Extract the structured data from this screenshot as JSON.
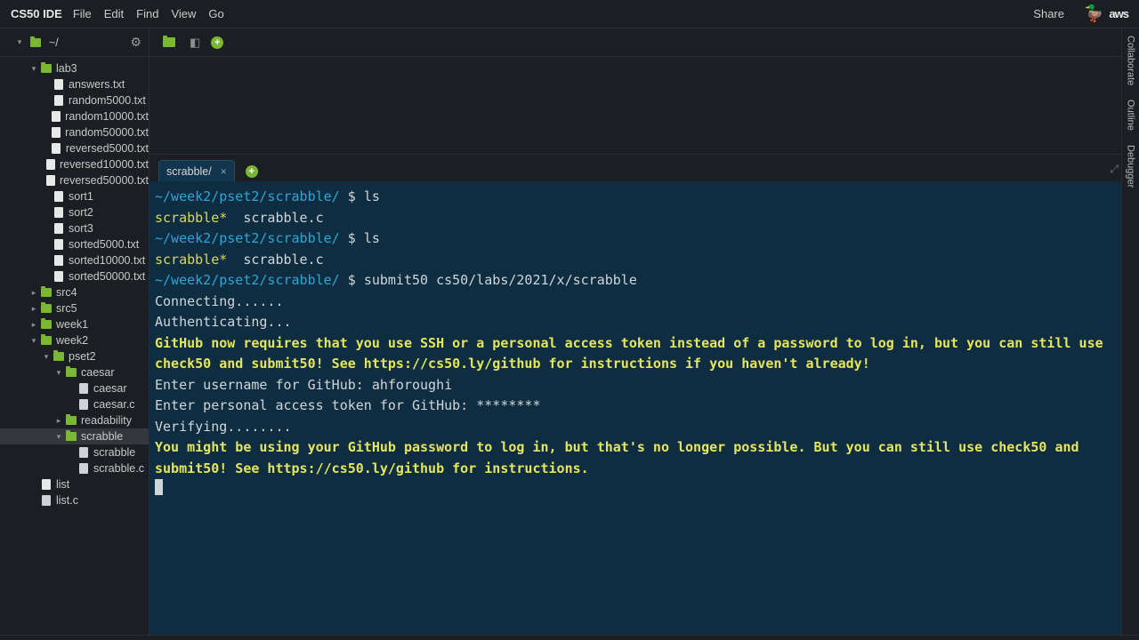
{
  "menubar": {
    "brand": "CS50 IDE",
    "items": [
      "File",
      "Edit",
      "Find",
      "View",
      "Go"
    ],
    "share": "Share",
    "cloud_brand": "aws"
  },
  "sidebar": {
    "root_label": "~/",
    "gear_icon": "gear",
    "tree": [
      {
        "depth": 0,
        "type": "folder-open",
        "twisty": true,
        "expanded": true,
        "label": "lab3"
      },
      {
        "depth": 1,
        "type": "file",
        "label": "answers.txt"
      },
      {
        "depth": 1,
        "type": "file",
        "label": "random5000.txt"
      },
      {
        "depth": 1,
        "type": "file",
        "label": "random10000.txt"
      },
      {
        "depth": 1,
        "type": "file",
        "label": "random50000.txt"
      },
      {
        "depth": 1,
        "type": "file",
        "label": "reversed5000.txt"
      },
      {
        "depth": 1,
        "type": "file",
        "label": "reversed10000.txt"
      },
      {
        "depth": 1,
        "type": "file",
        "label": "reversed50000.txt"
      },
      {
        "depth": 1,
        "type": "file",
        "label": "sort1"
      },
      {
        "depth": 1,
        "type": "file",
        "label": "sort2"
      },
      {
        "depth": 1,
        "type": "file",
        "label": "sort3"
      },
      {
        "depth": 1,
        "type": "file",
        "label": "sorted5000.txt"
      },
      {
        "depth": 1,
        "type": "file",
        "label": "sorted10000.txt"
      },
      {
        "depth": 1,
        "type": "file",
        "label": "sorted50000.txt"
      },
      {
        "depth": 0,
        "type": "folder-closed",
        "twisty": true,
        "expanded": false,
        "label": "src4"
      },
      {
        "depth": 0,
        "type": "folder-closed",
        "twisty": true,
        "expanded": false,
        "label": "src5"
      },
      {
        "depth": 0,
        "type": "folder-closed",
        "twisty": true,
        "expanded": false,
        "label": "week1"
      },
      {
        "depth": 0,
        "type": "folder-open",
        "twisty": true,
        "expanded": true,
        "label": "week2"
      },
      {
        "depth": 1,
        "type": "folder-open",
        "twisty": true,
        "expanded": true,
        "label": "pset2"
      },
      {
        "depth": 2,
        "type": "folder-open",
        "twisty": true,
        "expanded": true,
        "label": "caesar"
      },
      {
        "depth": 3,
        "type": "file",
        "docish": true,
        "label": "caesar"
      },
      {
        "depth": 3,
        "type": "file",
        "docish": true,
        "label": "caesar.c"
      },
      {
        "depth": 2,
        "type": "folder-closed",
        "twisty": true,
        "expanded": false,
        "label": "readability"
      },
      {
        "depth": 2,
        "type": "folder-open",
        "twisty": true,
        "expanded": true,
        "selected": true,
        "label": "scrabble"
      },
      {
        "depth": 3,
        "type": "file",
        "docish": true,
        "label": "scrabble"
      },
      {
        "depth": 3,
        "type": "file",
        "docish": true,
        "label": "scrabble.c"
      },
      {
        "depth": 0,
        "type": "file",
        "label": "list"
      },
      {
        "depth": 0,
        "type": "file",
        "docish": true,
        "label": "list.c"
      }
    ]
  },
  "tabs": {
    "active": "scrabble/"
  },
  "terminal": {
    "lines": [
      {
        "parts": [
          {
            "cls": "prompt",
            "t": "~/week2/pset2/scrabble/ "
          },
          {
            "cls": "dollar",
            "t": "$ "
          },
          {
            "cls": "cmd",
            "t": "ls"
          }
        ]
      },
      {
        "parts": [
          {
            "cls": "out-yellow",
            "t": "scrabble*"
          },
          {
            "cls": "cmd",
            "t": "  scrabble.c"
          }
        ]
      },
      {
        "parts": [
          {
            "cls": "prompt",
            "t": "~/week2/pset2/scrabble/ "
          },
          {
            "cls": "dollar",
            "t": "$ "
          },
          {
            "cls": "cmd",
            "t": "ls"
          }
        ]
      },
      {
        "parts": [
          {
            "cls": "out-yellow",
            "t": "scrabble*"
          },
          {
            "cls": "cmd",
            "t": "  scrabble.c"
          }
        ]
      },
      {
        "parts": [
          {
            "cls": "prompt",
            "t": "~/week2/pset2/scrabble/ "
          },
          {
            "cls": "dollar",
            "t": "$ "
          },
          {
            "cls": "cmd",
            "t": "submit50 cs50/labs/2021/x/scrabble"
          }
        ]
      },
      {
        "parts": [
          {
            "cls": "cmd",
            "t": "Connecting......"
          }
        ]
      },
      {
        "parts": [
          {
            "cls": "cmd",
            "t": "Authenticating..."
          }
        ]
      },
      {
        "parts": [
          {
            "cls": "yellow-bold",
            "t": "GitHub now requires that you use SSH or a personal access token instead of a password to log in, but you can still use check50 and submit50! See https://cs50.ly/github for instructions if you haven't already!"
          }
        ]
      },
      {
        "parts": [
          {
            "cls": "cmd",
            "t": "Enter username for GitHub: ahforoughi"
          }
        ]
      },
      {
        "parts": [
          {
            "cls": "cmd",
            "t": "Enter personal access token for GitHub: ********"
          }
        ]
      },
      {
        "parts": [
          {
            "cls": "cmd",
            "t": "Verifying........"
          }
        ]
      },
      {
        "parts": [
          {
            "cls": "yellow-bold",
            "t": "You might be using your GitHub password to log in, but that's no longer possible. But you can still use check50 and submit50! See https://cs50.ly/github for instructions."
          }
        ]
      }
    ]
  },
  "rightrail": {
    "items": [
      "Collaborate",
      "Outline",
      "Debugger"
    ]
  }
}
